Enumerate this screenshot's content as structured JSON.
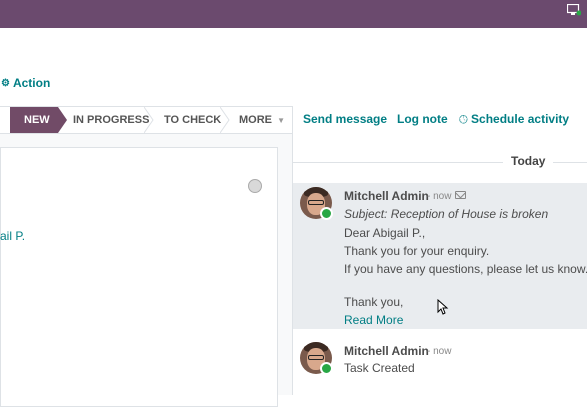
{
  "control_panel": {
    "action_label": "Action"
  },
  "stages": [
    {
      "label": "NEW",
      "active": true
    },
    {
      "label": "IN PROGRESS",
      "active": false
    },
    {
      "label": "TO CHECK",
      "active": false
    },
    {
      "label": "MORE",
      "active": false
    }
  ],
  "form": {
    "customer_fragment": "ail P."
  },
  "chatter": {
    "send_message": "Send message",
    "log_note": "Log note",
    "schedule_activity": "Schedule activity",
    "date_separator": "Today",
    "messages": [
      {
        "author": "Mitchell Admin",
        "when": "- now",
        "subject": "Subject: Reception of House is broken",
        "body": [
          "Dear Abigail P.,",
          "Thank you for your enquiry.",
          "If you have any questions, please let us know.",
          "",
          "Thank you,"
        ],
        "read_more": "Read More"
      },
      {
        "author": "Mitchell Admin",
        "when": "- now",
        "body": [
          "Task Created"
        ]
      }
    ]
  },
  "colors": {
    "brand": "#714b67",
    "topbar": "#6b4a6e",
    "link": "#017e84",
    "online": "#28a745"
  }
}
